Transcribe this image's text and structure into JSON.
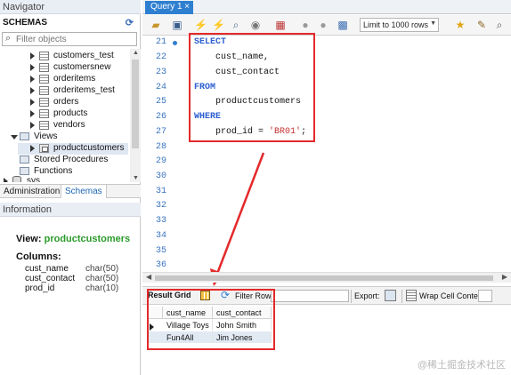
{
  "navigator": {
    "title": "Navigator",
    "schemas_label": "SCHEMAS",
    "filter_placeholder": "Filter objects",
    "tree": [
      "customers_test",
      "customersnew",
      "orderitems",
      "orderitems_test",
      "orders",
      "products",
      "vendors"
    ],
    "views_label": "Views",
    "view_item": "productcustomers",
    "stored_procedures": "Stored Procedures",
    "functions": "Functions",
    "sys": "sys",
    "tabs": [
      "Administration",
      "Schemas"
    ],
    "active_tab": "Schemas"
  },
  "information": {
    "title": "Information",
    "view_prefix": "View:",
    "view_name": "productcustomers",
    "columns_label": "Columns:",
    "columns": [
      {
        "name": "cust_name",
        "type": "char(50)"
      },
      {
        "name": "cust_contact",
        "type": "char(50)"
      },
      {
        "name": "prod_id",
        "type": "char(10)"
      }
    ]
  },
  "editor": {
    "tab_label": "Query 1",
    "tab_close": "×",
    "limit_label": "Limit to 1000 rows",
    "line_numbers": [
      "21",
      "22",
      "23",
      "24",
      "25",
      "26",
      "27",
      "28",
      "29",
      "30",
      "31",
      "32",
      "33",
      "34",
      "35",
      "36"
    ],
    "code": {
      "l21": "SELECT",
      "l22": "    cust_name,",
      "l23": "    cust_contact",
      "l24": "FROM",
      "l25": "    productcustomers",
      "l26": "WHERE",
      "l27_pre": "    prod_id = ",
      "l27_str": "'BR01'",
      "l27_post": ";"
    },
    "icons": [
      "folder-open-icon",
      "save-icon",
      "execute-icon",
      "execute-current-icon",
      "explain-icon",
      "stop-icon",
      "toggle-icon",
      "commit-icon",
      "rollback-icon",
      "autocommit-icon",
      "limit-dropdown",
      "bookmark-icon",
      "brush-icon",
      "search-icon"
    ]
  },
  "results": {
    "result_grid": "Result Grid",
    "filter_rows": "Filter Rows:",
    "export": "Export:",
    "wrap_cell": "Wrap Cell Content:",
    "columns": [
      "cust_name",
      "cust_contact"
    ],
    "rows": [
      [
        "Village Toys",
        "John Smith"
      ],
      [
        "Fun4All",
        "Jim Jones"
      ]
    ]
  },
  "watermark": "@稀土掘金技术社区",
  "colors": {
    "accent": "#2f7fd1",
    "highlight_box": "#e4292b",
    "keyword": "#2d5fd1",
    "string": "#c42f2f",
    "view_name": "#2a9a2a"
  }
}
